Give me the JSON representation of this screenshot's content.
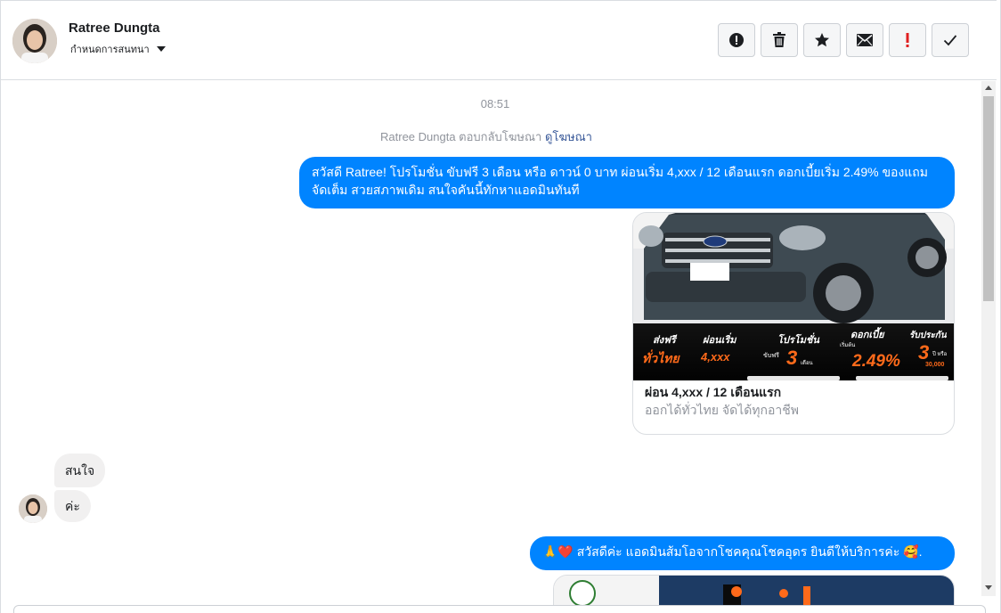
{
  "header": {
    "contact_name": "Ratree Dungta",
    "assign_label": "กำหนดการสนทนา",
    "toolbar": {
      "spam_label": "spam",
      "delete_label": "delete",
      "star_label": "star",
      "unread_label": "unread",
      "follow_up_label": "follow up",
      "done_label": "done"
    }
  },
  "conversation": {
    "timestamp": "08:51",
    "reply_note_prefix": "Ratree Dungta ตอบกลับโฆษณา",
    "reply_note_link": "ดูโฆษณา",
    "messages": [
      {
        "from": "page",
        "text": "สวัสดี Ratree! โปรโมชั่น ขับฟรี 3 เดือน หรือ ดาวน์ 0 บาท ผ่อนเริ่ม 4,xxx / 12 เดือนแรก ดอกเบี้ยเริ่ม 2.49% ของแถมจัดเต็ม สวยสภาพเดิม สนใจคันนี้ทักหาแอดมินทันที"
      },
      {
        "from": "contact",
        "text": "สนใจ"
      },
      {
        "from": "contact",
        "text": "ค่ะ"
      },
      {
        "from": "page",
        "text": "🙏❤️ สวัสดีค่ะ แอดมินส้มโอจากโชคคุณโชคอุดร ยินดีให้บริการค่ะ 🥰."
      }
    ],
    "ad_card": {
      "title": "ผ่อน 4,xxx / 12 เดือนแรก",
      "subtitle": "ออกได้ทั่วไทย จัดได้ทุกอาชีพ",
      "banner": {
        "free_shipping_top": "ส่งฟรี",
        "free_shipping_bottom": "ทั่วไทย",
        "installment_top": "ผ่อนเริ่ม",
        "installment_value": "4,xxx",
        "promo_top": "โปรโมชั่น",
        "promo_prefix": "ขับฟรี",
        "promo_value": "3",
        "promo_unit": "เดือน",
        "interest_top": "ดอกเบี้ย",
        "interest_prefix": "เริ่มต้น",
        "interest_value": "2.49%",
        "insurance_top": "รับประกัน",
        "insurance_value": "3",
        "insurance_unit": "ปี หรือ",
        "insurance_km": "30,000"
      }
    }
  },
  "colors": {
    "outgoing_bubble": "#0084ff",
    "incoming_bubble": "#f1f0f0",
    "link": "#385898",
    "banner_accent": "#ff6a1a"
  }
}
